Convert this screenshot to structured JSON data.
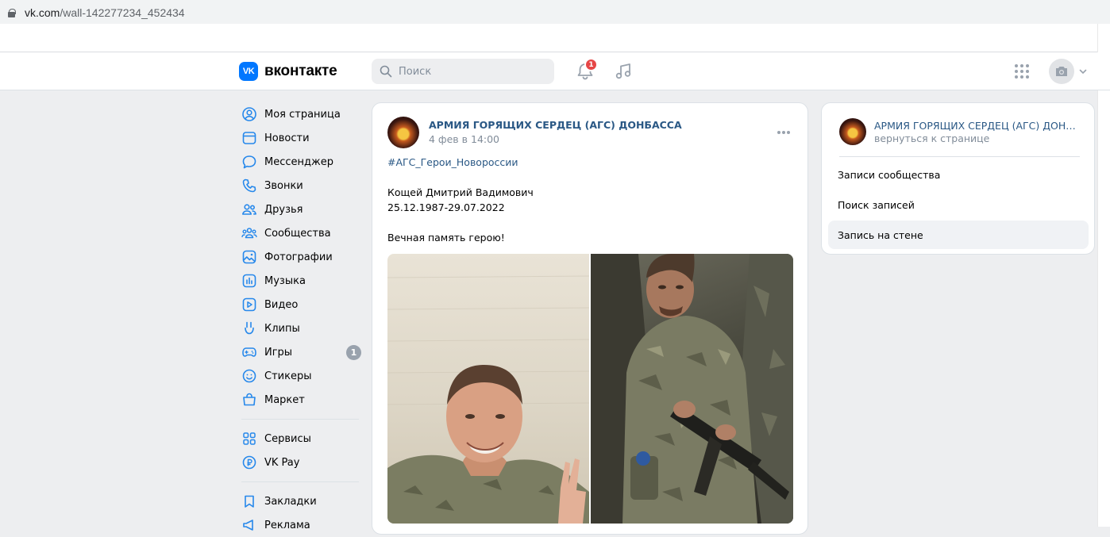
{
  "browser": {
    "url_domain": "vk.com",
    "url_path": "/wall-142277234_452434"
  },
  "header": {
    "logo_text": "вконтакте",
    "logo_mark": "VK",
    "search_placeholder": "Поиск",
    "notifications_count": "1",
    "icons": [
      "bell-icon",
      "music-icon",
      "apps-grid-icon",
      "camera-icon",
      "chevron-down-icon"
    ]
  },
  "sidebar": {
    "items": [
      {
        "label": "Моя страница",
        "icon": "user-circle-icon"
      },
      {
        "label": "Новости",
        "icon": "news-icon"
      },
      {
        "label": "Мессенджер",
        "icon": "message-icon"
      },
      {
        "label": "Звонки",
        "icon": "phone-icon"
      },
      {
        "label": "Друзья",
        "icon": "friends-icon"
      },
      {
        "label": "Сообщества",
        "icon": "communities-icon"
      },
      {
        "label": "Фотографии",
        "icon": "photo-icon"
      },
      {
        "label": "Музыка",
        "icon": "music-icon"
      },
      {
        "label": "Видео",
        "icon": "video-icon"
      },
      {
        "label": "Клипы",
        "icon": "clips-icon"
      },
      {
        "label": "Игры",
        "icon": "games-icon",
        "badge": "1"
      },
      {
        "label": "Стикеры",
        "icon": "stickers-icon"
      },
      {
        "label": "Маркет",
        "icon": "market-icon"
      }
    ],
    "items2": [
      {
        "label": "Сервисы",
        "icon": "services-icon"
      },
      {
        "label": "VK Pay",
        "icon": "vkpay-icon"
      }
    ],
    "items3": [
      {
        "label": "Закладки",
        "icon": "bookmark-icon"
      },
      {
        "label": "Реклама",
        "icon": "ads-icon"
      }
    ]
  },
  "post": {
    "author": "АРМИЯ ГОРЯЩИХ СЕРДЕЦ (АГС) ДОНБАССА",
    "date": "4 фев в 14:00",
    "hashtag": "#АГС_Герои_Новороссии",
    "line1": "Кощей Дмитрий Вадимович",
    "line2": "25.12.1987-29.07.2022",
    "line3": "Вечная память герою!",
    "photos": [
      "photo-portrait",
      "photo-soldier"
    ]
  },
  "right_panel": {
    "title": "АРМИЯ ГОРЯЩИХ СЕРДЕЦ (АГС) ДОНБАССА",
    "subtitle": "вернуться к странице",
    "items": [
      "Записи сообщества",
      "Поиск записей",
      "Запись на стене"
    ],
    "active_index": 2
  },
  "colors": {
    "brand": "#0077ff",
    "link": "#2a5885",
    "secondary_text": "#818c99",
    "page_bg": "#edeef0",
    "badge_red": "#e64646"
  }
}
